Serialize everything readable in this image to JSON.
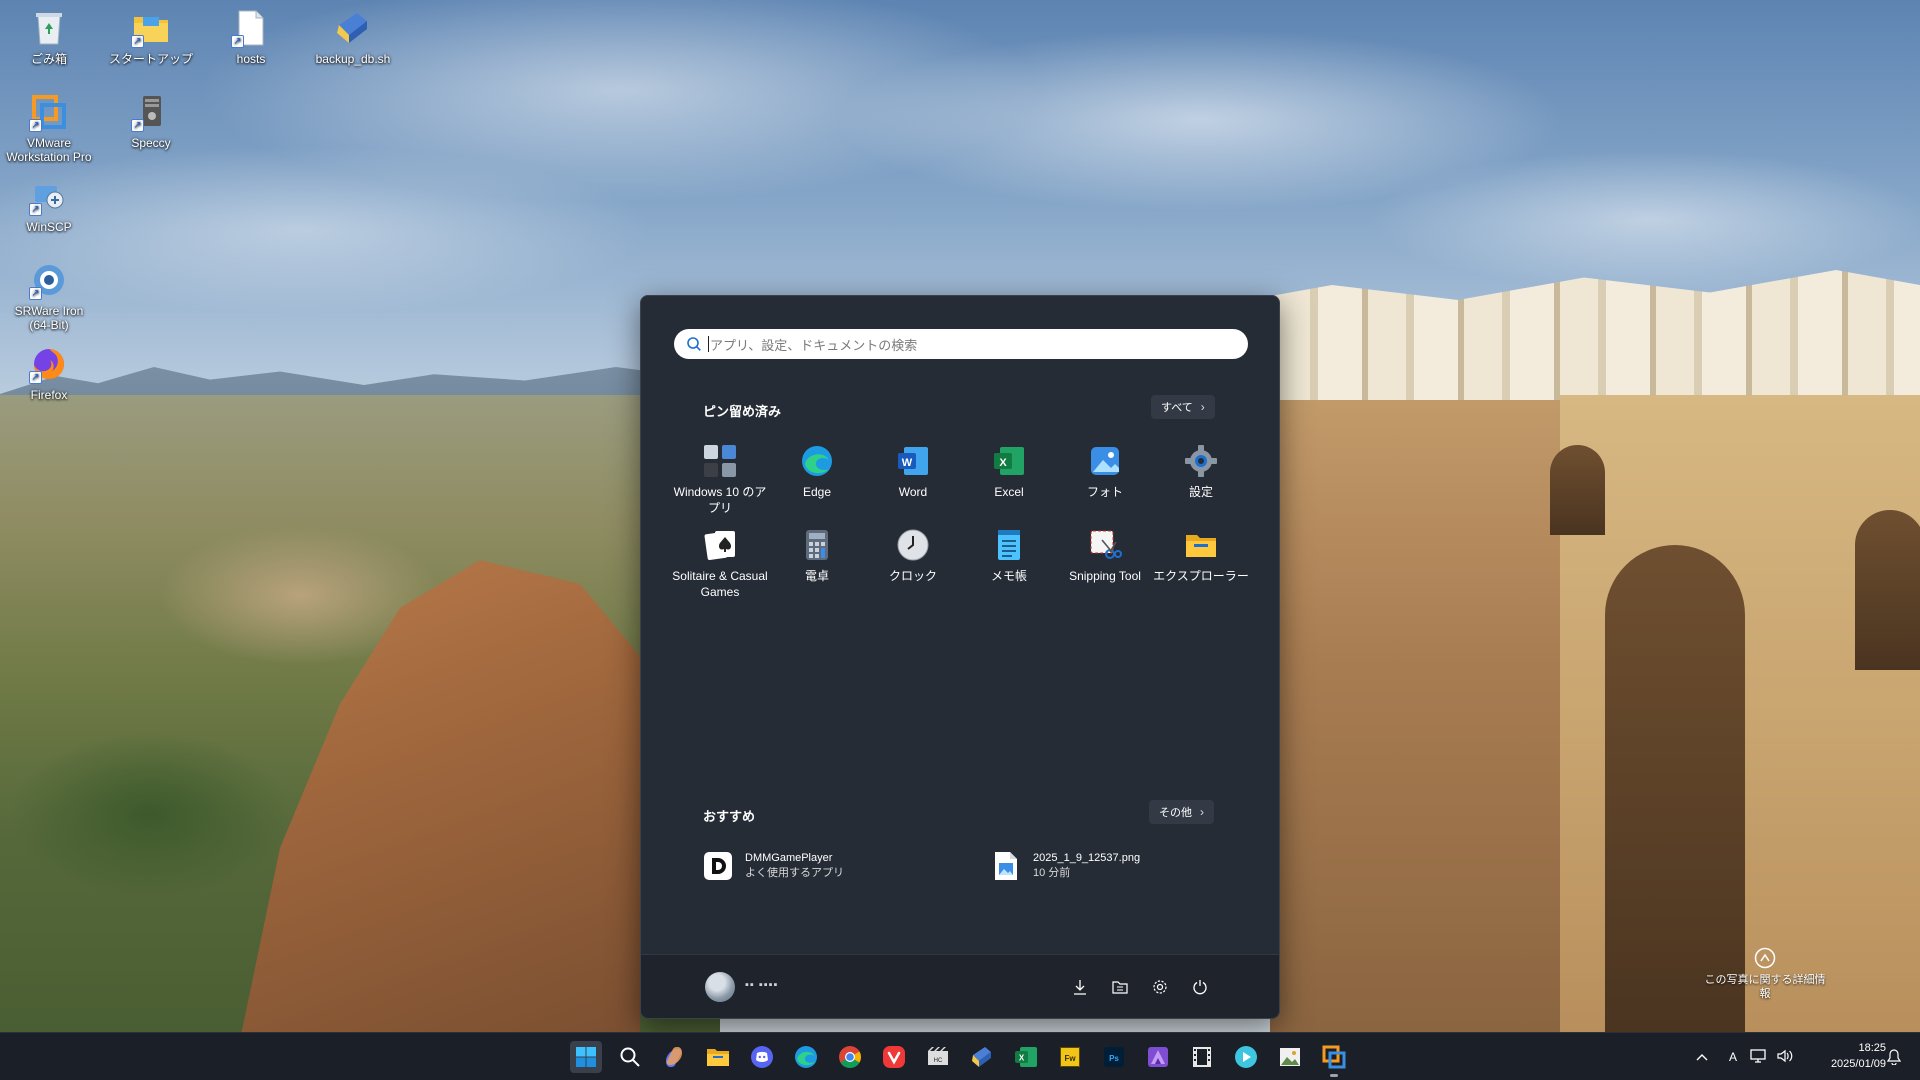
{
  "desktop": {
    "icons": [
      {
        "label": "ごみ箱",
        "icon": "recycle-bin-icon"
      },
      {
        "label": "スタートアップ",
        "icon": "folder-shortcut-icon"
      },
      {
        "label": "hosts",
        "icon": "file-icon"
      },
      {
        "label": "backup_db.sh",
        "icon": "script-icon"
      },
      {
        "label": "VMware Workstation Pro",
        "icon": "vmware-icon"
      },
      {
        "label": "Speccy",
        "icon": "speccy-icon"
      },
      {
        "label": "WinSCP",
        "icon": "winscp-icon"
      },
      {
        "label": "SRWare Iron (64-Bit)",
        "icon": "iron-browser-icon"
      },
      {
        "label": "Firefox",
        "icon": "firefox-icon"
      }
    ],
    "photo_info": "この写真に関する詳細情報"
  },
  "start_menu": {
    "search_placeholder": "アプリ、設定、ドキュメントの検索",
    "pinned_title": "ピン留め済み",
    "all_button": "すべて",
    "pinned_apps": [
      {
        "label": "Windows 10 のアプリ",
        "icon": "windows10-apps-icon"
      },
      {
        "label": "Edge",
        "icon": "edge-icon"
      },
      {
        "label": "Word",
        "icon": "word-icon"
      },
      {
        "label": "Excel",
        "icon": "excel-icon"
      },
      {
        "label": "フォト",
        "icon": "photos-icon"
      },
      {
        "label": "設定",
        "icon": "settings-gear-icon"
      },
      {
        "label": "Solitaire & Casual Games",
        "icon": "solitaire-icon"
      },
      {
        "label": "電卓",
        "icon": "calculator-icon"
      },
      {
        "label": "クロック",
        "icon": "clock-icon"
      },
      {
        "label": "メモ帳",
        "icon": "notepad-icon"
      },
      {
        "label": "Snipping Tool",
        "icon": "snipping-tool-icon"
      },
      {
        "label": "エクスプローラー",
        "icon": "file-explorer-icon"
      }
    ],
    "recommended_title": "おすすめ",
    "more_button": "その他",
    "recommended": [
      {
        "title": "DMMGamePlayer",
        "subtitle": "よく使用するアプリ",
        "icon": "dmm-game-player-icon"
      },
      {
        "title": "2025_1_9_12537.png",
        "subtitle": "10 分前",
        "icon": "image-file-icon"
      }
    ],
    "footer": {
      "username": "▪▪ ▪▪▪▪",
      "buttons": [
        "downloads-icon",
        "documents-folder-icon",
        "settings-icon",
        "power-icon"
      ]
    }
  },
  "taskbar": {
    "apps": [
      "start-icon",
      "search-icon",
      "copilot-icon",
      "file-explorer-icon",
      "discord-icon",
      "edge-icon",
      "chrome-icon",
      "vivaldi-icon",
      "media-player-classic-icon",
      "script-editor-icon",
      "excel-icon",
      "fireworks-icon",
      "photoshop-icon",
      "affinity-photo-icon",
      "video-editor-icon",
      "media-player-icon",
      "image-viewer-icon",
      "vmware-icon"
    ],
    "tray": {
      "ime_indicator": "A",
      "time": "18:25",
      "date": "2025/01/09"
    }
  },
  "colors": {
    "start_bg": "#262c36",
    "taskbar_bg": "#1b1f27",
    "accent": "#3a8ee6"
  }
}
